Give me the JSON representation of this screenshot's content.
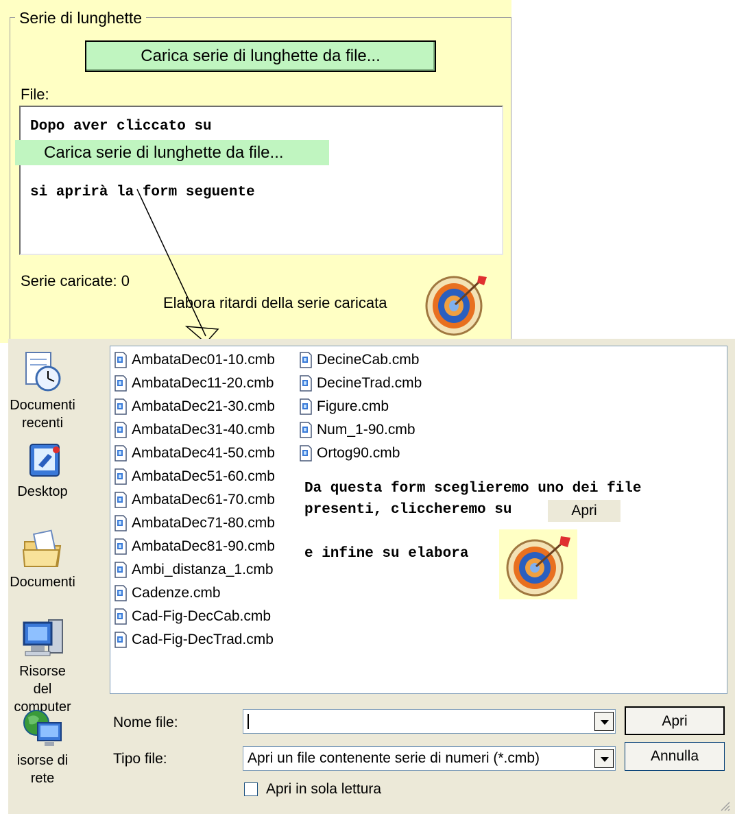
{
  "panel": {
    "group_title": "Serie di lunghette",
    "load_button": "Carica serie di lunghette da file...",
    "file_label": "File:",
    "note_line_1": "Dopo aver cliccato su",
    "note_highlight": "Carica serie di lunghette da file...",
    "note_line_2": "si aprirà la form seguente",
    "series_loaded": "Serie caricate: 0",
    "process_label": "Elabora ritardi della serie caricata"
  },
  "dialog": {
    "places": [
      {
        "label": "Documenti recenti",
        "icon": "recent-documents-icon"
      },
      {
        "label": "Desktop",
        "icon": "desktop-icon"
      },
      {
        "label": "Documenti",
        "icon": "documents-folder-icon"
      },
      {
        "label": "Risorse del computer",
        "icon": "my-computer-icon"
      },
      {
        "label": "isorse di rete",
        "icon": "network-places-icon"
      }
    ],
    "files_col1": [
      "AmbataDec01-10.cmb",
      "AmbataDec11-20.cmb",
      "AmbataDec21-30.cmb",
      "AmbataDec31-40.cmb",
      "AmbataDec41-50.cmb",
      "AmbataDec51-60.cmb",
      "AmbataDec61-70.cmb",
      "AmbataDec71-80.cmb",
      "AmbataDec81-90.cmb",
      "Ambi_distanza_1.cmb",
      "Cadenze.cmb",
      "Cad-Fig-DecCab.cmb",
      "Cad-Fig-DecTrad.cmb"
    ],
    "files_col2": [
      "DecineCab.cmb",
      "DecineTrad.cmb",
      "Figure.cmb",
      "Num_1-90.cmb",
      "Ortog90.cmb"
    ],
    "instructions": {
      "line1": "Da questa form sceglieremo uno dei file",
      "line2": "presenti, cliccheremo su",
      "apri_chip": "Apri",
      "line3": "e infine su elabora"
    },
    "name_label": "Nome file:",
    "name_value": "",
    "type_label": "Tipo file:",
    "type_value": "Apri un file contenente serie di numeri (*.cmb)",
    "open_button": "Apri",
    "cancel_button": "Annulla",
    "readonly_label": "Apri in sola lettura",
    "readonly_checked": false
  },
  "colors": {
    "panel_bg": "#ffffc4",
    "button_green": "#c0f5c0",
    "dialog_bg": "#ece9d8"
  }
}
